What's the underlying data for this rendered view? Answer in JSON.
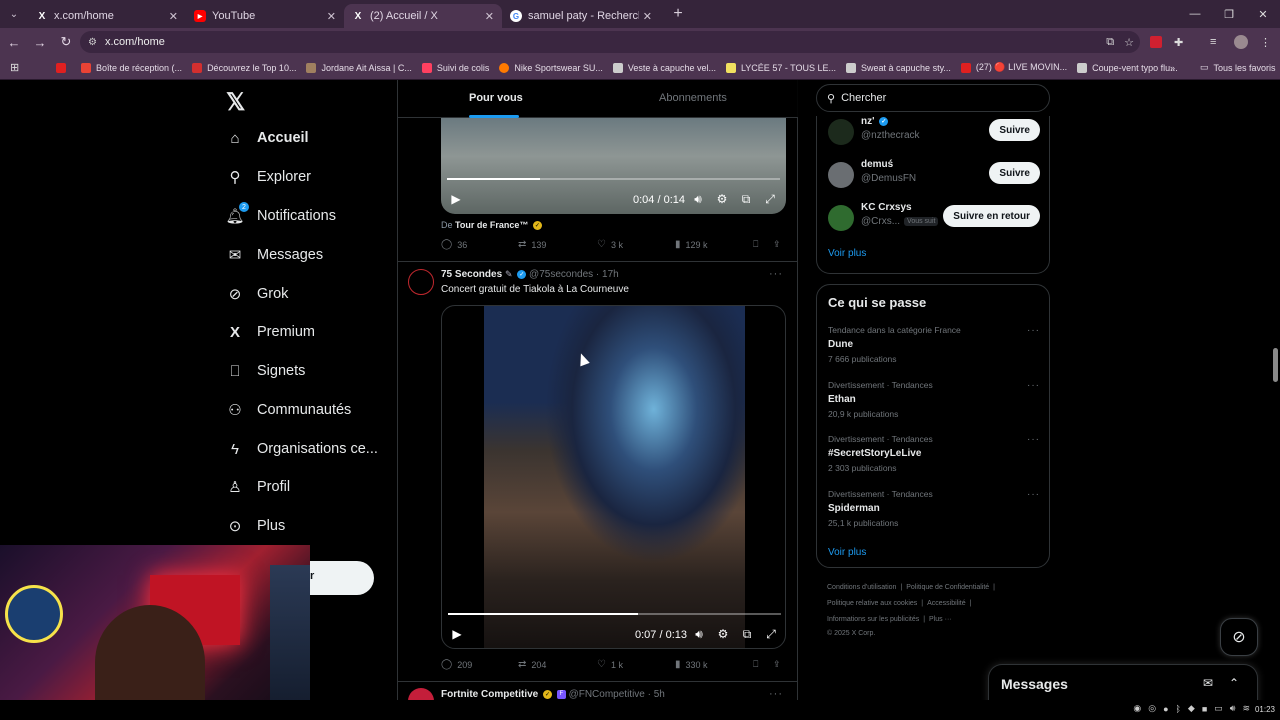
{
  "browser": {
    "tabs": [
      {
        "title": "x.com/home",
        "icon": "x-logo-icon",
        "active": false
      },
      {
        "title": "YouTube",
        "icon": "youtube-icon",
        "active": false
      },
      {
        "title": "(2) Accueil / X",
        "icon": "x-logo-icon",
        "active": true
      },
      {
        "title": "samuel paty - Recherche Google",
        "icon": "google-icon",
        "active": false
      }
    ],
    "url": "x.com/home",
    "bookmarks": [
      {
        "label": "",
        "color": "#e02020"
      },
      {
        "label": "Boîte de réception (...",
        "color": "#ea4335"
      },
      {
        "label": "Découvrez le Top 10...",
        "color": "#d32f2f"
      },
      {
        "label": "Jordane Ait Aissa | C...",
        "color": "#a08060"
      },
      {
        "label": "Suivi de colis",
        "color": "#ff4060"
      },
      {
        "label": "Nike Sportswear SU...",
        "color": "#ff7a00"
      },
      {
        "label": "Veste à capuche vel...",
        "color": "#cccccc"
      },
      {
        "label": "LYCÉE 57 - TOUS LE...",
        "color": "#f0e060"
      },
      {
        "label": "Sweat à capuche sty...",
        "color": "#cccccc"
      },
      {
        "label": "(27) 🔴 LIVE MOVIN...",
        "color": "#e02020"
      },
      {
        "label": "Coupe-vent typo flu...",
        "color": "#cccccc"
      }
    ],
    "all_bookmarks": "Tous les favoris"
  },
  "nav": {
    "items": [
      {
        "label": "Accueil",
        "icon": "home-icon",
        "glyph": "⌂",
        "bold": true
      },
      {
        "label": "Explorer",
        "icon": "search-icon",
        "glyph": "⚲"
      },
      {
        "label": "Notifications",
        "icon": "bell-icon",
        "glyph": "♫",
        "badge": "2"
      },
      {
        "label": "Messages",
        "icon": "mail-icon",
        "glyph": "✉"
      },
      {
        "label": "Grok",
        "icon": "grok-icon",
        "glyph": "⊘"
      },
      {
        "label": "Premium",
        "icon": "x-premium-icon",
        "glyph": "X"
      },
      {
        "label": "Signets",
        "icon": "bookmark-icon",
        "glyph": "⎕"
      },
      {
        "label": "Communautés",
        "icon": "communities-icon",
        "glyph": "⚇"
      },
      {
        "label": "Organisations ce...",
        "icon": "lightning-icon",
        "glyph": "ϟ"
      },
      {
        "label": "Profil",
        "icon": "profile-icon",
        "glyph": "♙"
      },
      {
        "label": "Plus",
        "icon": "more-circle-icon",
        "glyph": "⊙"
      }
    ],
    "post_button_char": "r"
  },
  "feed": {
    "tabs": [
      "Pour vous",
      "Abonnements"
    ],
    "post1": {
      "time": "0:04 / 0:14",
      "progress": 0.28,
      "source_prefix": "De",
      "source_name": "Tour de France™",
      "replies": "36",
      "reposts": "139",
      "likes": "3 k",
      "views": "129 k"
    },
    "post2": {
      "name": "75 Secondes",
      "handle": "@75secondes · 17h",
      "text": "Concert gratuit de Tiakola à La Courneuve",
      "time": "0:07 / 0:13",
      "progress": 0.57,
      "replies": "209",
      "reposts": "204",
      "likes": "1 k",
      "views": "330 k"
    },
    "post3": {
      "name": "Fortnite Competitive",
      "handle": "@FNCompetitive · 5h"
    }
  },
  "right": {
    "search_placeholder": "Chercher",
    "suggestions": [
      {
        "name": "nz'",
        "handle": "@nzthecrack",
        "button": "Suivre",
        "verified": true,
        "avatar_color": "#1c2a1c"
      },
      {
        "name": "demuś",
        "handle": "@DemusFN",
        "button": "Suivre",
        "verified": false,
        "avatar_color": "#6a6e72"
      },
      {
        "name": "KC Crxsys",
        "handle": "@Crxs...",
        "follows_you": "Vous suit",
        "button": "Suivre en retour",
        "verified": false,
        "avatar_color": "#2f6b2f"
      }
    ],
    "show_more": "Voir plus",
    "trends_title": "Ce qui se passe",
    "trends": [
      {
        "meta": "Tendance dans la catégorie France",
        "name": "Dune",
        "count": "7 666 publications"
      },
      {
        "meta": "Divertissement · Tendances",
        "name": "Ethan",
        "count": "20,9 k publications"
      },
      {
        "meta": "Divertissement · Tendances",
        "name": "#SecretStoryLeLive",
        "count": "2 303 publications"
      },
      {
        "meta": "Divertissement · Tendances",
        "name": "Spiderman",
        "count": "25,1 k publications"
      }
    ],
    "trends_more": "Voir plus",
    "footer": {
      "l1a": "Conditions d'utilisation",
      "l1b": "Politique de Confidentialité",
      "l2a": "Politique relative aux cookies",
      "l2b": "Accessibilité",
      "l3a": "Informations sur les publicités",
      "l3b": "Plus ···",
      "copyright": "© 2025 X Corp."
    }
  },
  "messages_drawer": {
    "title": "Messages"
  },
  "taskbar": {
    "time": "01:23"
  }
}
